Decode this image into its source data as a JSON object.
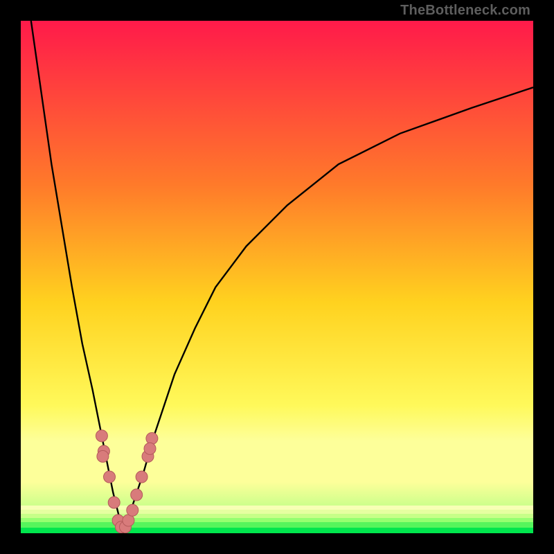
{
  "watermark": "TheBottleneck.com",
  "colors": {
    "frame": "#000000",
    "grad_top": "#ff1a4a",
    "grad_mid1": "#ff7a2a",
    "grad_mid2": "#ffd21f",
    "grad_mid3": "#fff95a",
    "grad_paleyellow": "#fdff9a",
    "grad_palegreen": "#c9ff8a",
    "grad_green": "#00e64d",
    "curve": "#000000",
    "dot_fill": "#d87b7b",
    "dot_stroke": "#b45a5a"
  },
  "chart_data": {
    "type": "line",
    "title": "",
    "xlabel": "",
    "ylabel": "",
    "xlim": [
      0,
      100
    ],
    "ylim": [
      0,
      100
    ],
    "min_x": 20,
    "series": [
      {
        "name": "left-branch",
        "x": [
          2,
          4,
          6,
          8,
          10,
          12,
          14,
          16,
          17,
          18,
          19,
          20
        ],
        "y": [
          100,
          86,
          72,
          60,
          48,
          37,
          28,
          18,
          13,
          8,
          4,
          0
        ]
      },
      {
        "name": "right-branch",
        "x": [
          20,
          21,
          22,
          24,
          26,
          28,
          30,
          34,
          38,
          44,
          52,
          62,
          74,
          88,
          100
        ],
        "y": [
          0,
          3,
          6,
          12,
          19,
          25,
          31,
          40,
          48,
          56,
          64,
          72,
          78,
          83,
          87
        ]
      }
    ],
    "dots": [
      {
        "x": 15.8,
        "y": 19
      },
      {
        "x": 16.2,
        "y": 16
      },
      {
        "x": 16.0,
        "y": 15
      },
      {
        "x": 17.3,
        "y": 11
      },
      {
        "x": 18.2,
        "y": 6
      },
      {
        "x": 19.0,
        "y": 2.5
      },
      {
        "x": 19.6,
        "y": 1.2
      },
      {
        "x": 20.4,
        "y": 1.2
      },
      {
        "x": 21.0,
        "y": 2.5
      },
      {
        "x": 21.8,
        "y": 4.5
      },
      {
        "x": 22.6,
        "y": 7.5
      },
      {
        "x": 23.6,
        "y": 11
      },
      {
        "x": 24.8,
        "y": 15
      },
      {
        "x": 25.6,
        "y": 18.5
      },
      {
        "x": 25.2,
        "y": 16.5
      }
    ]
  }
}
